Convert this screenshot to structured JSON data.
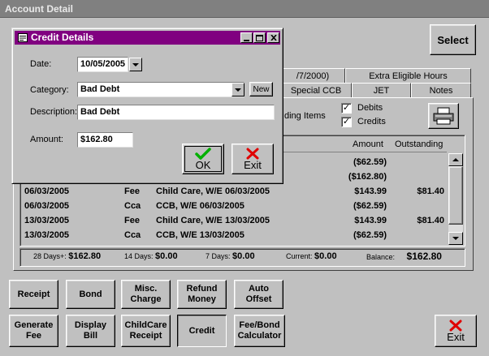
{
  "main_window": {
    "title": "Account Detail"
  },
  "select_button": "Select",
  "tabs_row1": [
    "/7/2000)",
    "Extra Eligible Hours"
  ],
  "tabs_row2": [
    "Special CCB",
    "JET",
    "Notes"
  ],
  "filter": {
    "partial_label": "ding Items",
    "debits_label": "Debits",
    "debits_checked": true,
    "credits_label": "Credits",
    "credits_checked": true,
    "checkmark": "✓"
  },
  "grid": {
    "headers": {
      "amount": "Amount",
      "outstanding": "Outstanding"
    },
    "rows": [
      {
        "date": "",
        "type": "",
        "description": "",
        "amount": "($62.59)",
        "outstanding": ""
      },
      {
        "date": "",
        "type": "",
        "description": "",
        "amount": "($162.80)",
        "outstanding": ""
      },
      {
        "date": "06/03/2005",
        "type": "Fee",
        "description": "Child Care, W/E 06/03/2005",
        "amount": "$143.99",
        "outstanding": "$81.40"
      },
      {
        "date": "06/03/2005",
        "type": "Cca",
        "description": "CCB, W/E 06/03/2005",
        "amount": "($62.59)",
        "outstanding": ""
      },
      {
        "date": "13/03/2005",
        "type": "Fee",
        "description": "Child Care, W/E 13/03/2005",
        "amount": "$143.99",
        "outstanding": "$81.40"
      },
      {
        "date": "13/03/2005",
        "type": "Cca",
        "description": "CCB, W/E 13/03/2005",
        "amount": "($62.59)",
        "outstanding": ""
      }
    ]
  },
  "summary": {
    "days28_label": "28 Days+:",
    "days28_value": "$162.80",
    "days14_label": "14 Days:",
    "days14_value": "$0.00",
    "days7_label": "7 Days:",
    "days7_value": "$0.00",
    "current_label": "Current:",
    "current_value": "$0.00",
    "balance_label": "Balance:",
    "balance_value": "$162.80"
  },
  "actions": [
    [
      "Receipt",
      "Bond",
      "Misc.\nCharge",
      "Refund\nMoney",
      "Auto\nOffset"
    ],
    [
      "Generate\nFee",
      "Display\nBill",
      "ChildCare\nReceipt",
      "Credit",
      "Fee/Bond\nCalculator"
    ]
  ],
  "exit_main": "Exit",
  "dialog": {
    "title": "Credit Details",
    "date_label": "Date:",
    "date_value": "10/05/2005",
    "category_label": "Category:",
    "category_value": "Bad Debt",
    "new_button": "New",
    "description_label": "Description:",
    "description_value": "Bad Debt",
    "amount_label": "Amount:",
    "amount_value": "$162.80",
    "ok_label": "OK",
    "exit_label": "Exit"
  },
  "colors": {
    "main_title_bar": "#808080",
    "dialog_title_bar": "#800080",
    "ok_check": "#00b000",
    "exit_x": "#e00000"
  }
}
